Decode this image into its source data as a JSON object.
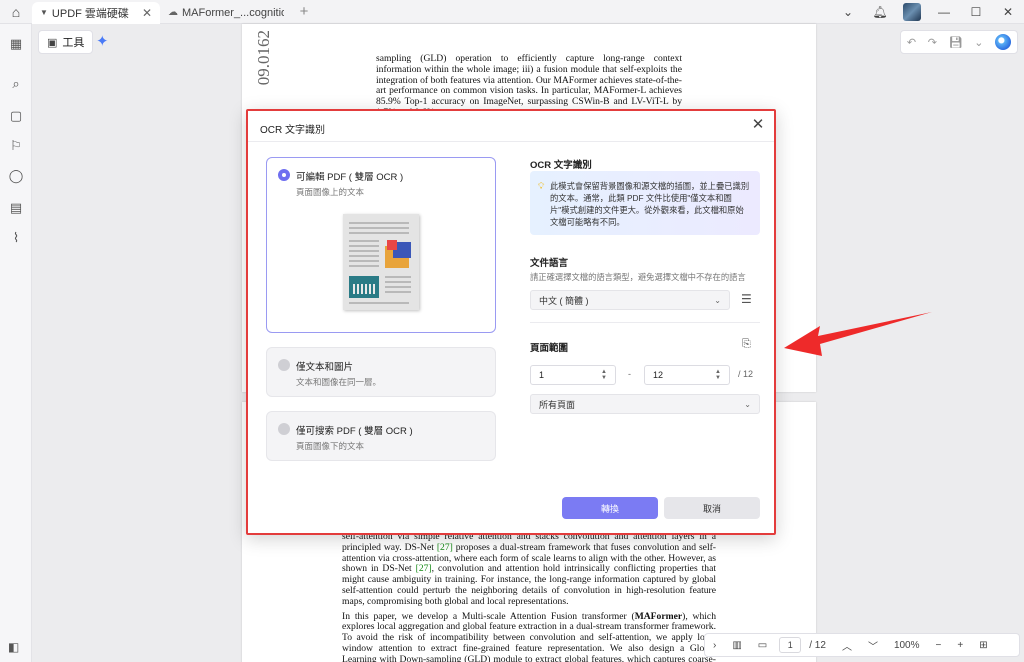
{
  "tabs": [
    {
      "label": "UPDF 雲端硬碟",
      "active": true
    },
    {
      "label": "MAFormer_...cognition",
      "active": false
    }
  ],
  "toolbar": {
    "tools_label": "工具",
    "close_label": "關閉"
  },
  "doc": {
    "margin_id": "09.0162",
    "page1_text": "sampling (GLD) operation to efficiently capture long-range context information within the whole image; iii) a fusion module that self-exploits the integration of both features via attention. Our MAFormer achieves state-of-the-art performance on common vision tasks. In particular, MAFormer-L achieves 85.9% Top-1 accuracy on ImageNet, surpassing CSWin-B and LV-ViT-L by 1.7% and 0.6%",
    "page2_p1_a": "self-attention via simple relative attention and stacks convolution and attention layers in a principled way. DS-Net ",
    "page2_cite1": "[27]",
    "page2_p1_b": " proposes a dual-stream framework that fuses convolution and self-attention via cross-attention, where each form of scale learns to align with the other. However, as shown in DS-Net ",
    "page2_cite2": "[27]",
    "page2_p1_c": ", convolution and attention hold intrinsically conflicting properties that might cause ambiguity in training. For instance, the long-range information captured by global self-attention could perturb the neighboring details of convolution in high-resolution feature maps, compromising both global and local representations.",
    "page2_p2_a": "In this paper, we develop a Multi-scale Attention Fusion transformer (",
    "page2_p2_bold": "MAFormer",
    "page2_p2_b": "), which explores local aggregation and global feature extraction in a dual-stream transformer framework. To avoid the risk of incompatibility between convolution and self-attention, we apply local window attention to extract fine-grained feature representation. We also design a Global Learning with Down-sampling (GLD) module to extract global features, which captures coarse-grained features based on the i"
  },
  "dialog": {
    "title": "OCR 文字識別",
    "options": [
      {
        "title": "可編輯 PDF ( 雙層 OCR )",
        "sub": "頁面圖像上的文本",
        "selected": true
      },
      {
        "title": "僅文本和圖片",
        "sub": "文本和圖像在同一層。",
        "selected": false
      },
      {
        "title": "僅可搜索 PDF ( 雙層 OCR )",
        "sub": "頁面圖像下的文本",
        "selected": false
      }
    ],
    "section_ocr": "OCR 文字識別",
    "info_text": "此模式會保留背景圖像和源文檔的插圖，並上疊已識別的文本。通常，此類 PDF 文件比使用\"僅文本和圖片\"模式創建的文件更大。從外觀來看，此文檔和原始文檔可能略有不同。",
    "section_lang": "文件語言",
    "lang_hint": "請正確選擇文檔的語言類型，避免選擇文檔中不存在的語言",
    "lang_value": "中文 ( 簡體 )",
    "section_range": "頁面範圍",
    "range_from": "1",
    "range_to": "12",
    "range_dash": "-",
    "range_total": "/ 12",
    "pages_value": "所有頁面",
    "convert_label": "轉換",
    "cancel_label": "取消"
  },
  "status": {
    "page_current": "1",
    "page_total": "/ 12",
    "zoom": "100%"
  },
  "colors": {
    "accent": "#7b7bf3",
    "highlight_border": "#e33c3c",
    "arrow": "#ee2a2a"
  }
}
